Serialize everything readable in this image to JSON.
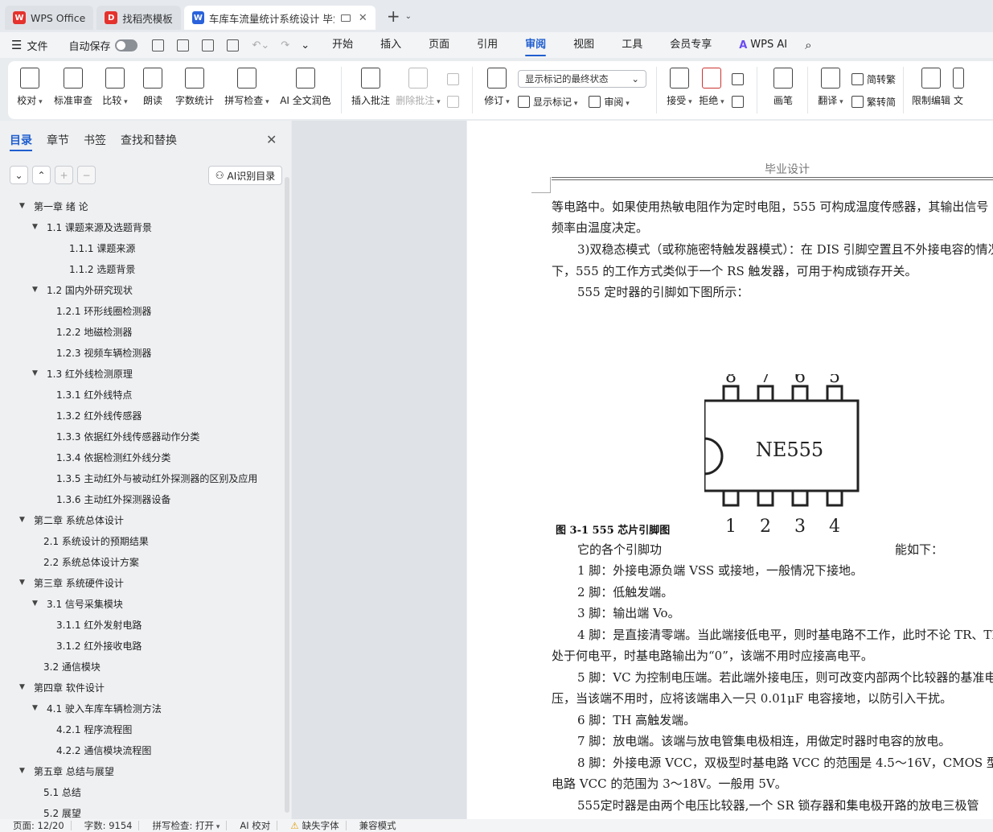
{
  "tabs": [
    {
      "label": "WPS Office",
      "icon": "wps-icon",
      "color": "#e5322d",
      "active": false
    },
    {
      "label": "找稻壳模板",
      "icon": "docer-icon",
      "color": "#e5322d",
      "active": false
    },
    {
      "label": "车库车流量统计系统设计 毕业",
      "icon": "writer-icon",
      "color": "#2a62db",
      "active": true
    }
  ],
  "menubar": {
    "file": "文件",
    "autosave": "自动保存",
    "tabs": [
      "开始",
      "插入",
      "页面",
      "引用",
      "审阅",
      "视图",
      "工具",
      "会员专享",
      "WPS AI"
    ],
    "active_tab": "审阅"
  },
  "ribbon": {
    "proof": "校对",
    "standard_review": "标准审查",
    "compare": "比较",
    "read_aloud": "朗读",
    "word_count": "字数统计",
    "spell_check": "拼写检查",
    "ai_proof": "AI 全文润色",
    "insert_comment": "插入批注",
    "delete_comment": "删除批注",
    "track": "修订",
    "markup_select": "显示标记的最终状态",
    "show_markup": "显示标记",
    "review": "审阅",
    "accept": "接受",
    "reject": "拒绝",
    "ink": "画笔",
    "translate": "翻译",
    "to_traditional": "简转繁",
    "to_simplified": "繁转简",
    "restrict_edit": "限制编辑",
    "doc_more": "文"
  },
  "nav": {
    "tabs": [
      "目录",
      "章节",
      "书签",
      "查找和替换"
    ],
    "active_tab": "目录",
    "ai_button": "AI识别目录",
    "toc": [
      {
        "label": "第一章  绪    论",
        "level": 1,
        "expand": true
      },
      {
        "label": "1.1  课题来源及选题背景",
        "level": 2,
        "expand": true
      },
      {
        "label": "1.1.1 课题来源",
        "level": 3,
        "expand": false
      },
      {
        "label": "1.1.2  选题背景",
        "level": 3,
        "expand": false
      },
      {
        "label": "1.2  国内外研究现状",
        "level": 2,
        "expand": true
      },
      {
        "label": "1.2.1 环形线圈检测器",
        "level": 3,
        "expand": false
      },
      {
        "label": "1.2.2 地磁检测器",
        "level": 3,
        "expand": false
      },
      {
        "label": "1.2.3 视频车辆检测器",
        "level": 3,
        "expand": false
      },
      {
        "label": "1.3 红外线检测原理",
        "level": 2,
        "expand": true
      },
      {
        "label": "1.3.1 红外线特点",
        "level": 3,
        "expand": false
      },
      {
        "label": "1.3.2 红外线传感器",
        "level": 3,
        "expand": false
      },
      {
        "label": "1.3.3 依据红外线传感器动作分类",
        "level": 3,
        "expand": false
      },
      {
        "label": "1.3.4 依据检测红外线分类",
        "level": 3,
        "expand": false
      },
      {
        "label": "1.3.5 主动红外与被动红外探测器的区别及应用",
        "level": 3,
        "expand": false
      },
      {
        "label": "1.3.6 主动红外探测器设备",
        "level": 3,
        "expand": false
      },
      {
        "label": "第二章  系统总体设计",
        "level": 1,
        "expand": true
      },
      {
        "label": "2.1 系统设计的预期结果",
        "level": 2,
        "expand": false
      },
      {
        "label": "2.2 系统总体设计方案",
        "level": 2,
        "expand": false
      },
      {
        "label": "第三章  系统硬件设计",
        "level": 1,
        "expand": true
      },
      {
        "label": "3.1 信号采集模块",
        "level": 2,
        "expand": true
      },
      {
        "label": "3.1.1 红外发射电路",
        "level": 3,
        "expand": false
      },
      {
        "label": "3.1.2  红外接收电路",
        "level": 3,
        "expand": false
      },
      {
        "label": "3.2 通信模块",
        "level": 2,
        "expand": false
      },
      {
        "label": "第四章  软件设计",
        "level": 1,
        "expand": true
      },
      {
        "label": "4.1 驶入车库车辆检测方法",
        "level": 2,
        "expand": true
      },
      {
        "label": "4.2.1 程序流程图",
        "level": 3,
        "expand": false
      },
      {
        "label": "4.2.2  通信模块流程图",
        "level": 3,
        "expand": false
      },
      {
        "label": "第五章  总结与展望",
        "level": 1,
        "expand": true
      },
      {
        "label": "5.1  总结",
        "level": 2,
        "expand": false
      },
      {
        "label": "5.2  展望",
        "level": 2,
        "expand": false
      }
    ]
  },
  "document": {
    "header": "毕业设计",
    "lines": [
      "等电路中。如果使用热敏电阻作为定时电阻，555 可构成温度传感器，其输出信号",
      "频率由温度决定。",
      "3)双稳态模式（或称施密特触发器模式）：在 DIS 引脚空置且不外接电容的情况",
      "下，555 的工作方式类似于一个 RS 触发器，可用于构成锁存开关。",
      "555 定时器的引脚如下图所示："
    ],
    "chip_label": "NE555",
    "pins_top": [
      "8",
      "7",
      "6",
      "5"
    ],
    "pins_bottom": [
      "1",
      "2",
      "3",
      "4"
    ],
    "figure_caption": "图 3-1  555 芯片引脚图",
    "pin_intro_left": "它的各个引脚功",
    "pin_intro_right": "能如下：",
    "pin_lines": [
      "1 脚：外接电源负端 VSS 或接地，一般情况下接地。",
      "2 脚：低触发端。",
      "3 脚：输出端 Vo。",
      "4 脚：是直接清零端。当此端接低电平，则时基电路不工作，此时不论 TR、TH",
      "处于何电平，时基电路输出为“0”，该端不用时应接高电平。",
      "5 脚：VC 为控制电压端。若此端外接电压，则可改变内部两个比较器的基准电",
      "压，当该端不用时，应将该端串入一只 0.01μF 电容接地，以防引入干扰。",
      "6 脚：TH 高触发端。",
      "7 脚：放电端。该端与放电管集电极相连，用做定时器时电容的放电。",
      "8 脚：外接电源 VCC，双极型时基电路 VCC 的范围是 4.5～16V，CMOS 型时基",
      "电路 VCC 的范围为 3～18V。一般用 5V。",
      "555定时器是由两个电压比较器,一个 SR 锁存器和集电极开路的放电三极管"
    ]
  },
  "status": {
    "page": "页面: 12/20",
    "words": "字数: 9154",
    "spell": "拼写检查: 打开",
    "ai_proof": "AI 校对",
    "missing_font": "缺失字体",
    "compat": "兼容模式"
  }
}
